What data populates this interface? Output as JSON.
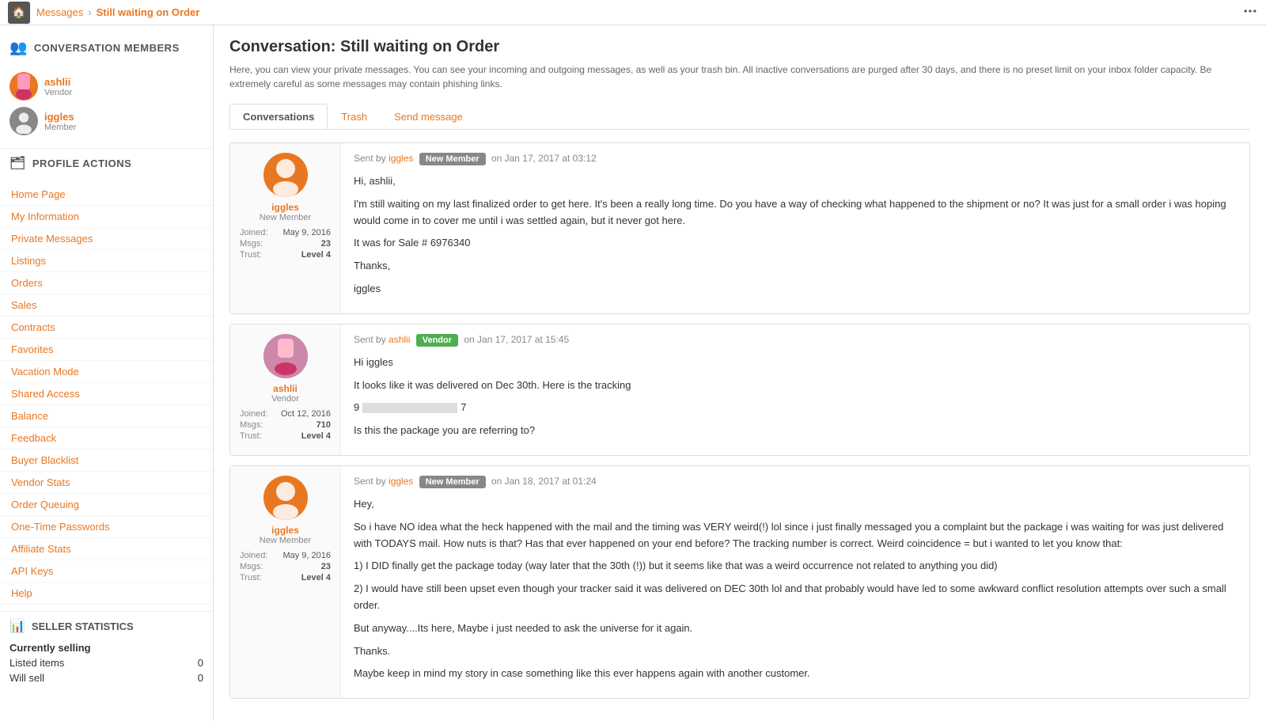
{
  "topnav": {
    "home_icon": "🏠",
    "breadcrumbs": [
      "Messages",
      "Still waiting on Order"
    ],
    "manage_icon": "⚙"
  },
  "sidebar": {
    "conversation_members_label": "CONVERSATION MEMBERS",
    "members": [
      {
        "name": "ashlii",
        "role": "Vendor",
        "avatar_type": "image"
      },
      {
        "name": "iggles",
        "role": "Member",
        "avatar_type": "generic"
      }
    ],
    "profile_actions_label": "PROFILE ACTIONS",
    "links": [
      "Home Page",
      "My Information",
      "Private Messages",
      "Listings",
      "Orders",
      "Sales",
      "Contracts",
      "Favorites",
      "Vacation Mode",
      "Shared Access",
      "Balance",
      "Feedback",
      "Buyer Blacklist",
      "Vendor Stats",
      "Order Queuing",
      "One-Time Passwords",
      "Affiliate Stats",
      "API Keys",
      "Help"
    ],
    "seller_stats_label": "SELLER STATISTICS",
    "stats": [
      {
        "label": "Currently selling",
        "value": ""
      },
      {
        "label": "Listed items",
        "value": "0"
      },
      {
        "label": "Will sell",
        "value": "0"
      }
    ]
  },
  "main": {
    "page_title": "Conversation: Still waiting on Order",
    "page_description": "Here, you can view your private messages. You can see your incoming and outgoing messages, as well as your trash bin. All inactive conversations are purged after 30 days, and there is no preset limit on your inbox folder capacity. Be extremely careful as some messages may contain phishing links.",
    "tabs": [
      {
        "label": "Conversations",
        "active": true
      },
      {
        "label": "Trash",
        "active": false
      },
      {
        "label": "Send message",
        "active": false
      }
    ],
    "messages": [
      {
        "sender": "iggles",
        "sender_role": "New Member",
        "sender_badge_type": "gray",
        "date": "Jan 17, 2017 at 03:12",
        "avatar_type": "generic",
        "avatar_color": "orange",
        "user_link": "iggles",
        "joined": "May 9, 2016",
        "msgs": "23",
        "trust": "Level 4",
        "body_lines": [
          "Hi, ashlii,",
          "I'm still waiting on my last finalized order to get here. It's been a really long time. Do you have a way of checking what happened to the shipment or no? It was just for a small order i was hoping would come in to cover me until i was settled again, but it never got here.",
          "It was for Sale # 6976340",
          "Thanks,",
          "iggles"
        ]
      },
      {
        "sender": "ashlii",
        "sender_role": "Vendor",
        "sender_badge_type": "green",
        "date": "Jan 17, 2017 at 15:45",
        "avatar_type": "image",
        "avatar_color": "purple",
        "user_link": "ashlii",
        "joined": "Oct 12, 2016",
        "msgs": "710",
        "trust": "Level 4",
        "body_lines": [
          "Hi iggles",
          "It looks like it was delivered on Dec 30th. Here is the tracking",
          "TRACKING_REDACTED",
          "Is this the package you are referring to?"
        ]
      },
      {
        "sender": "iggles",
        "sender_role": "New Member",
        "sender_badge_type": "gray",
        "date": "Jan 18, 2017 at 01:24",
        "avatar_type": "generic",
        "avatar_color": "orange",
        "user_link": "iggles",
        "joined": "May 9, 2016",
        "msgs": "23",
        "trust": "Level 4",
        "body_lines": [
          "Hey,",
          "So i have NO idea what the heck happened with the mail and the timing was VERY weird(!) lol since i just finally messaged you a complaint but the package i was waiting for was just delivered with TODAYS mail. How nuts is that? Has that ever happened on your end before? The tracking number is correct. Weird coincidence = but i wanted to let you know that:",
          "1) I DID finally get the package today (way later that the 30th (!)) but it seems like that was a weird occurrence not related to anything you did)",
          "2) I would have still been upset even though your tracker said it was delivered on DEC 30th lol and that probably would have led to some awkward conflict resolution attempts over such a small order.",
          "But anyway....Its here, Maybe i just needed to ask the universe for it again.",
          "Thanks.",
          "Maybe keep in mind my story in case something like this ever happens again with another customer."
        ]
      }
    ]
  }
}
